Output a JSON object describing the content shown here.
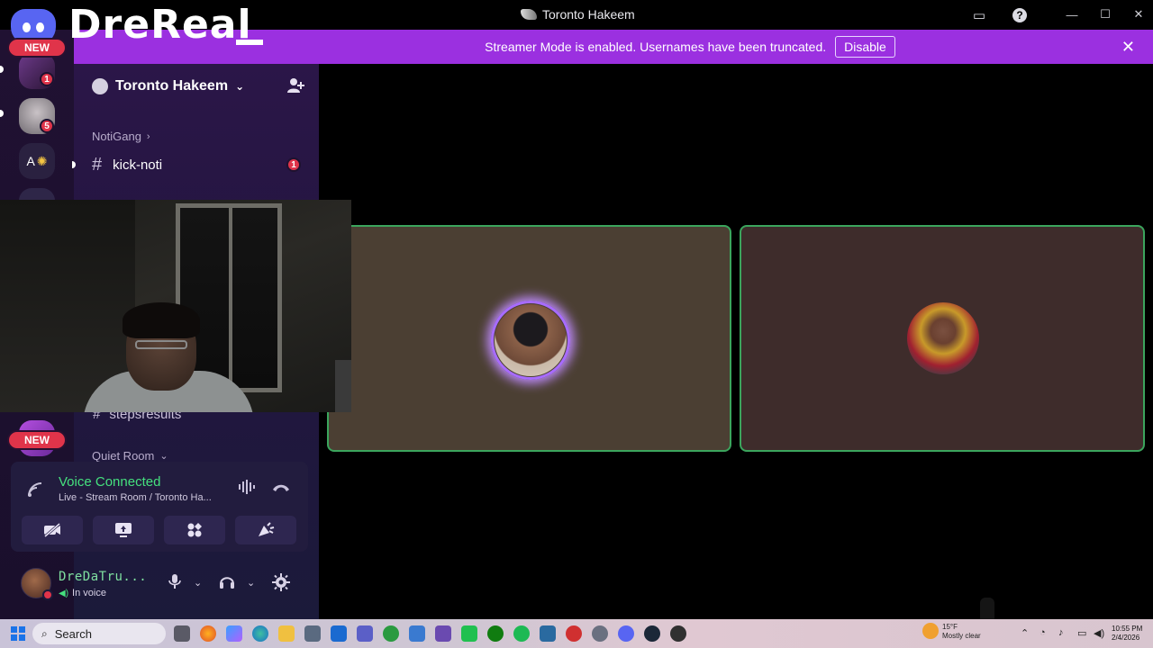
{
  "window": {
    "title": "Toronto Hakeem"
  },
  "overlay": {
    "watermark": "DreReal",
    "new_badge_top": "NEW",
    "new_badge_bottom": "NEW"
  },
  "banner": {
    "text": "Streamer Mode is enabled. Usernames have been truncated.",
    "disable_label": "Disable"
  },
  "rail": {
    "badges": [
      "1",
      "5"
    ],
    "server_initial": "A"
  },
  "sidebar": {
    "server_name": "Toronto Hakeem",
    "categories": [
      {
        "label": "NotiGang"
      },
      {
        "label": "Quiet Room"
      }
    ],
    "channels": [
      {
        "name": "kick-noti",
        "unread": "1"
      },
      {
        "name": "stepsresults"
      }
    ]
  },
  "voice": {
    "status": "Voice Connected",
    "location": "Live - Stream Room / Toronto Ha..."
  },
  "user": {
    "name": "DreDaTru...",
    "status": "In voice"
  },
  "taskbar": {
    "search_placeholder": "Search",
    "weather_temp": "15°F",
    "weather_desc": "Mostly clear",
    "time": "10:55 PM",
    "date": "2/4/2026"
  },
  "colors": {
    "accent_purple": "#9b30e0",
    "voice_green": "#45e07e",
    "speaking_ring": "#a86cff",
    "tile_border": "#3ba55d",
    "badge_red": "#e0344a"
  }
}
